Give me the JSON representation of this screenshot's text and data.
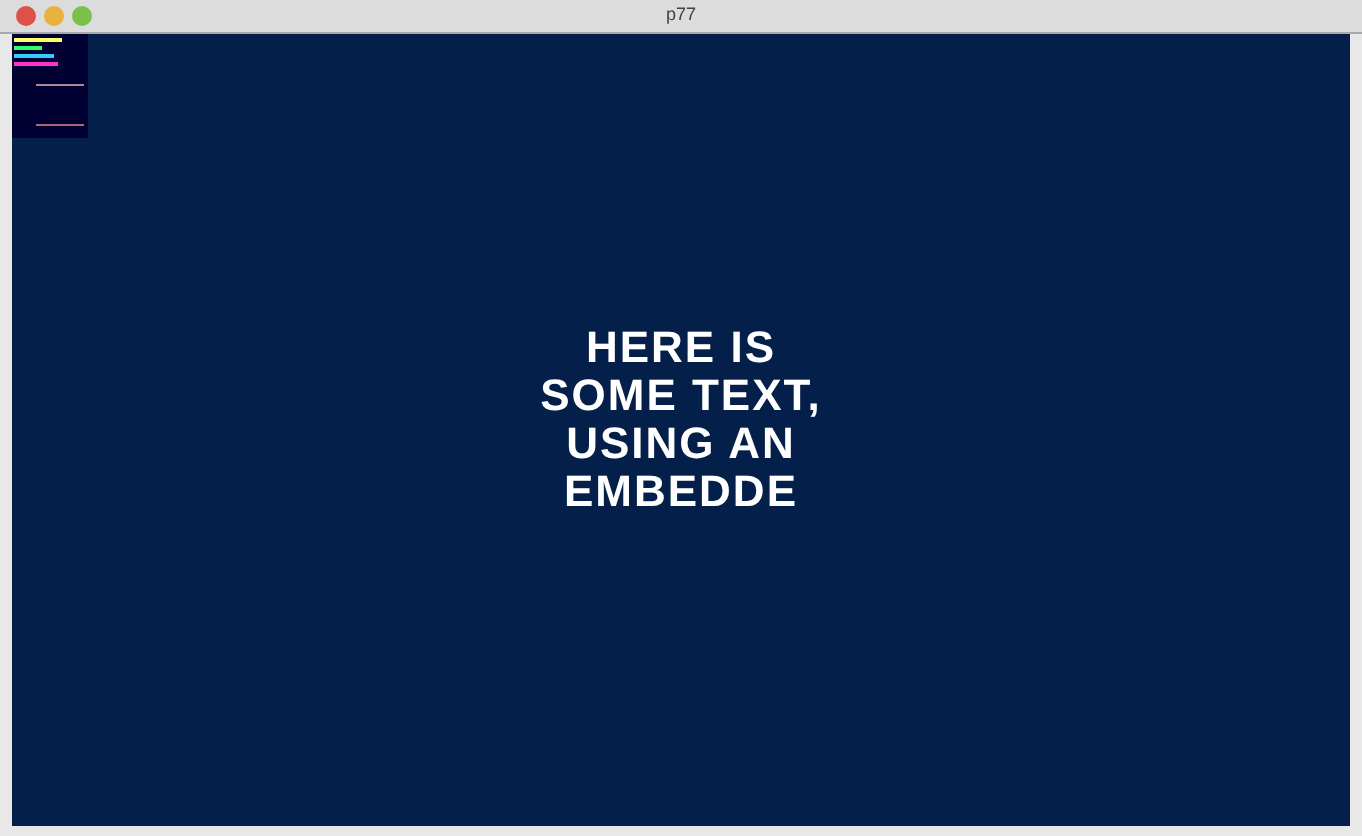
{
  "window": {
    "title": "p77"
  },
  "content": {
    "text": "HERE IS SOME TEXT, USING AN EMBEDDE"
  }
}
